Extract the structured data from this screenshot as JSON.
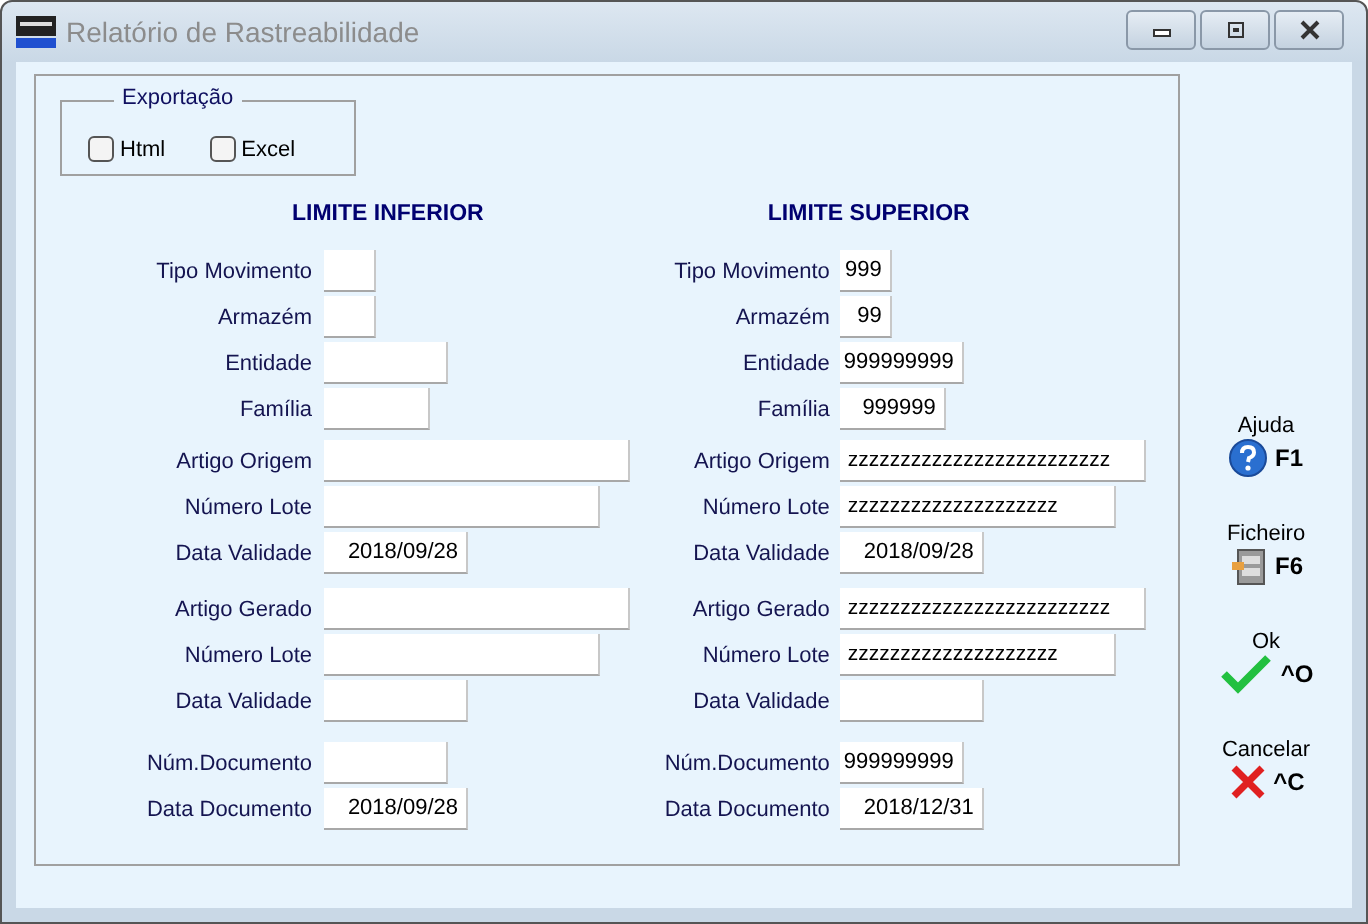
{
  "window": {
    "title": "Relatório de Rastreabilidade"
  },
  "export": {
    "title": "Exportação",
    "options": [
      {
        "label": "Html",
        "checked": false
      },
      {
        "label": "Excel",
        "checked": false
      }
    ]
  },
  "limits": [
    {
      "heading": "LIMITE INFERIOR",
      "groups": [
        [
          {
            "label": "Tipo Movimento"
          },
          {
            "label": "Armazém"
          },
          {
            "label": "Entidade"
          },
          {
            "label": "Família"
          }
        ],
        [
          {
            "label": "Artigo Origem"
          },
          {
            "label": "Número Lote"
          },
          {
            "label": "Data Validade",
            "value": "2018/09/28"
          }
        ],
        [
          {
            "label": "Artigo Gerado"
          },
          {
            "label": "Número Lote"
          },
          {
            "label": "Data Validade"
          }
        ],
        [
          {
            "label": "Núm.Documento"
          },
          {
            "label": "Data Documento",
            "value": "2018/09/28"
          }
        ]
      ]
    },
    {
      "heading": "LIMITE SUPERIOR",
      "groups": [
        [
          {
            "label": "Tipo Movimento",
            "value": "999"
          },
          {
            "label": "Armazém",
            "value": "99"
          },
          {
            "label": "Entidade",
            "value": "999999999"
          },
          {
            "label": "Família",
            "value": "999999"
          }
        ],
        [
          {
            "label": "Artigo Origem",
            "value": "zzzzzzzzzzzzzzzzzzzzzzzzz"
          },
          {
            "label": "Número Lote",
            "value": "zzzzzzzzzzzzzzzzzzzz"
          },
          {
            "label": "Data Validade",
            "value": "2018/09/28"
          }
        ],
        [
          {
            "label": "Artigo Gerado",
            "value": "zzzzzzzzzzzzzzzzzzzzzzzzz"
          },
          {
            "label": "Número Lote",
            "value": "zzzzzzzzzzzzzzzzzzzz"
          },
          {
            "label": "Data Validade"
          }
        ],
        [
          {
            "label": "Núm.Documento",
            "value": "999999999"
          },
          {
            "label": "Data Documento",
            "value": "2018/12/31"
          }
        ]
      ]
    }
  ],
  "actions": [
    {
      "caption": "Ajuda",
      "key": "F1",
      "kind": "help"
    },
    {
      "caption": "Ficheiro",
      "key": "F6",
      "kind": "file"
    },
    {
      "caption": "Ok",
      "key": "^O",
      "kind": "ok"
    },
    {
      "caption": "Cancelar",
      "key": "^C",
      "kind": "cancel"
    }
  ]
}
